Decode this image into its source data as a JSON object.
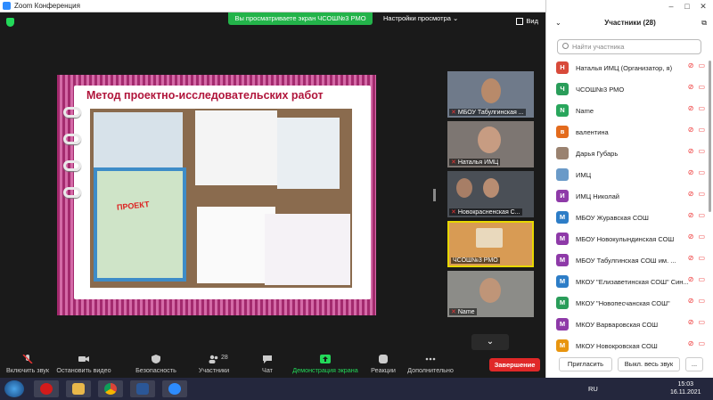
{
  "window": {
    "title": "Zoom Конференция"
  },
  "meeting": {
    "share_banner": "Вы просматриваете экран ЧСОШ№3 РМО",
    "view_options": "Настройки просмотра",
    "view_button": "Вид"
  },
  "slide": {
    "title": "Метод проектно-исследовательских работ",
    "photo_label": "ПРОЕКТ"
  },
  "video_tiles": [
    {
      "label": "МБОУ Табулгинская ..."
    },
    {
      "label": "Наталья ИМЦ"
    },
    {
      "label": "Новокрасненская С..."
    },
    {
      "label": "ЧСОШ№3 РМО"
    },
    {
      "label": "Name"
    }
  ],
  "toolbar": {
    "mute": "Включить звук",
    "video": "Остановить видео",
    "security": "Безопасность",
    "participants": "Участники",
    "participants_count": "28",
    "chat": "Чат",
    "share": "Демонстрация экрана",
    "reactions": "Реакции",
    "more": "Дополнительно",
    "end": "Завершение"
  },
  "panel": {
    "title": "Участники (28)",
    "search_placeholder": "Найти участника",
    "invite": "Пригласить",
    "mute_all": "Выкл. весь звук",
    "more": "..."
  },
  "participants": [
    {
      "initial": "Н",
      "name": "Наталья ИМЦ (Организатор, я)",
      "color": "#d84a3a"
    },
    {
      "initial": "Ч",
      "name": "ЧСОШ№3 РМО",
      "color": "#2a9d5a"
    },
    {
      "initial": "N",
      "name": "Name",
      "color": "#29a65c"
    },
    {
      "initial": "в",
      "name": "валентина",
      "color": "#e36b1d"
    },
    {
      "initial": "",
      "name": "Дарья Губарь",
      "color": "#9a8270"
    },
    {
      "initial": "",
      "name": "ИМЦ",
      "color": "#6a9ac8"
    },
    {
      "initial": "И",
      "name": "ИМЦ Николай",
      "color": "#8e3aa8"
    },
    {
      "initial": "М",
      "name": "МБОУ Журавская СОШ",
      "color": "#2d7dc7"
    },
    {
      "initial": "М",
      "name": "МБОУ Новокулындинская СОШ",
      "color": "#8e3aa8"
    },
    {
      "initial": "М",
      "name": "МБОУ Табулгинская СОШ им. ...",
      "color": "#8e3aa8"
    },
    {
      "initial": "М",
      "name": "МКОУ \"Елизаветинская СОШ\" Син...",
      "color": "#2d7dc7"
    },
    {
      "initial": "М",
      "name": "МКОУ \"Новопесчанская СОШ\"",
      "color": "#2a9d5a"
    },
    {
      "initial": "М",
      "name": "МКОУ Варваровская СОШ",
      "color": "#8e3aa8"
    },
    {
      "initial": "М",
      "name": "МКОУ Новокровская СОШ",
      "color": "#e8950f"
    }
  ],
  "taskbar": {
    "language": "RU",
    "time": "15:03",
    "date": "16.11.2021"
  }
}
